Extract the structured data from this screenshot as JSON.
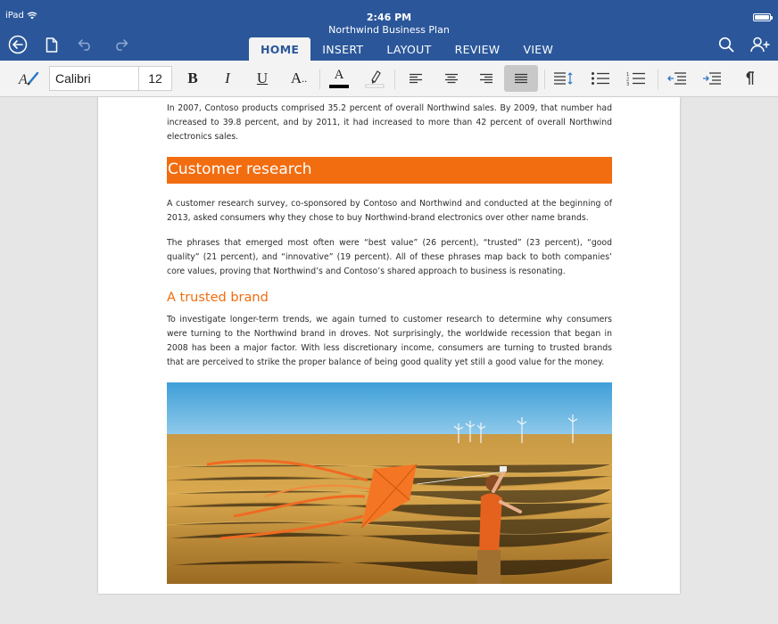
{
  "status": {
    "device": "iPad",
    "time": "2:46 PM"
  },
  "window": {
    "title": "Northwind Business Plan"
  },
  "tabs": [
    {
      "label": "HOME"
    },
    {
      "label": "INSERT"
    },
    {
      "label": "LAYOUT"
    },
    {
      "label": "REVIEW"
    },
    {
      "label": "VIEW"
    }
  ],
  "ribbon": {
    "font_name": "Calibri",
    "font_size": "12",
    "bold": "B",
    "italic": "I",
    "underline": "U",
    "font_effects": "A",
    "font_color": "A"
  },
  "colors": {
    "header": "#2b579a",
    "accent_orange": "#f26d10",
    "font_color_bar": "#000000"
  },
  "document": {
    "para1": "In 2007, Contoso products comprised 35.2 percent of overall Northwind sales. By 2009, that number had increased to 39.8 percent, and by 2011, it had increased to more than 42 percent of overall Northwind electronics sales.",
    "heading1": "Customer research",
    "para2": "A customer research survey, co-sponsored by Contoso and Northwind and conducted at the beginning of 2013, asked consumers why they chose to buy Northwind-brand electronics over other name brands.",
    "para3": "The phrases that emerged most often were “best value” (26 percent), “trusted” (23 percent), “good quality” (21 percent), and “innovative” (19 percent). All of these phrases map back to both companies’ core values, proving that Northwind’s and Contoso’s shared approach to business is resonating.",
    "heading2": "A trusted brand",
    "para4": "To investigate longer-term trends, we again turned to customer research to determine why consumers were turning to the Northwind brand in droves. Not surprisingly, the worldwide recession that began in 2008 has been a major factor. With less discretionary income, consumers are turning to trusted brands that are perceived to strike the proper balance of being good quality yet still a good value for the money."
  }
}
